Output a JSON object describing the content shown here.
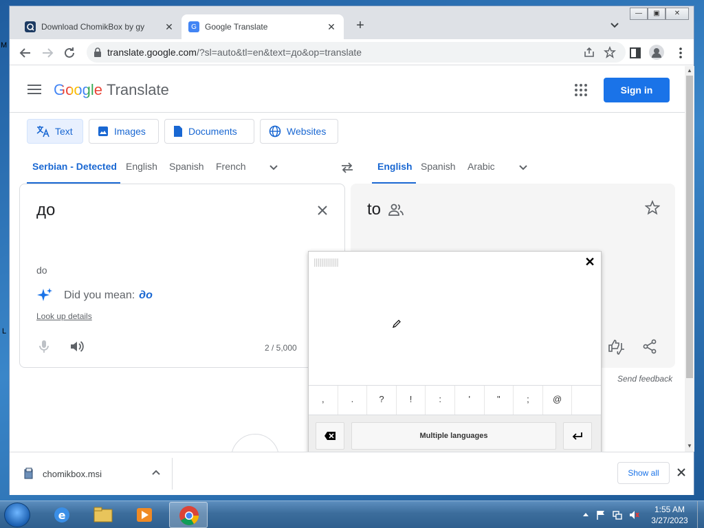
{
  "desktop": {
    "fragment_1": "M",
    "fragment_2": "L"
  },
  "browser": {
    "tabs": [
      {
        "title": "Download ChomikBox by gy",
        "favicon": "chomikbox-icon"
      },
      {
        "title": "Google Translate",
        "favicon": "google-translate-icon"
      }
    ],
    "url_host": "translate.google.com",
    "url_path": "/?sl=auto&tl=en&text=до&op=translate"
  },
  "header": {
    "logo": "Google",
    "logo_suffix": "Translate",
    "signin": "Sign in"
  },
  "modes": [
    "Text",
    "Images",
    "Documents",
    "Websites"
  ],
  "source_langs": [
    "Serbian - Detected",
    "English",
    "Spanish",
    "French"
  ],
  "target_langs": [
    "English",
    "Spanish",
    "Arabic"
  ],
  "source": {
    "text": "до",
    "transliteration": "do",
    "did_you_mean_label": "Did you mean:",
    "did_you_mean_value": "до",
    "lookup": "Look up details",
    "counter": "2 / 5,000"
  },
  "target": {
    "text": "to"
  },
  "feedback": "Send feedback",
  "keyboard": {
    "keys": [
      ",",
      ".",
      "?",
      "!",
      ":",
      "'",
      "\"",
      ";",
      "@",
      ""
    ],
    "language_button": "Multiple languages"
  },
  "downloads": {
    "file": "chomikbox.msi",
    "show_all": "Show all"
  },
  "taskbar": {
    "time": "1:55 AM",
    "date": "3/27/2023"
  },
  "colors": {
    "accent": "#1a73e8",
    "selected_lang": "#1967d2"
  }
}
